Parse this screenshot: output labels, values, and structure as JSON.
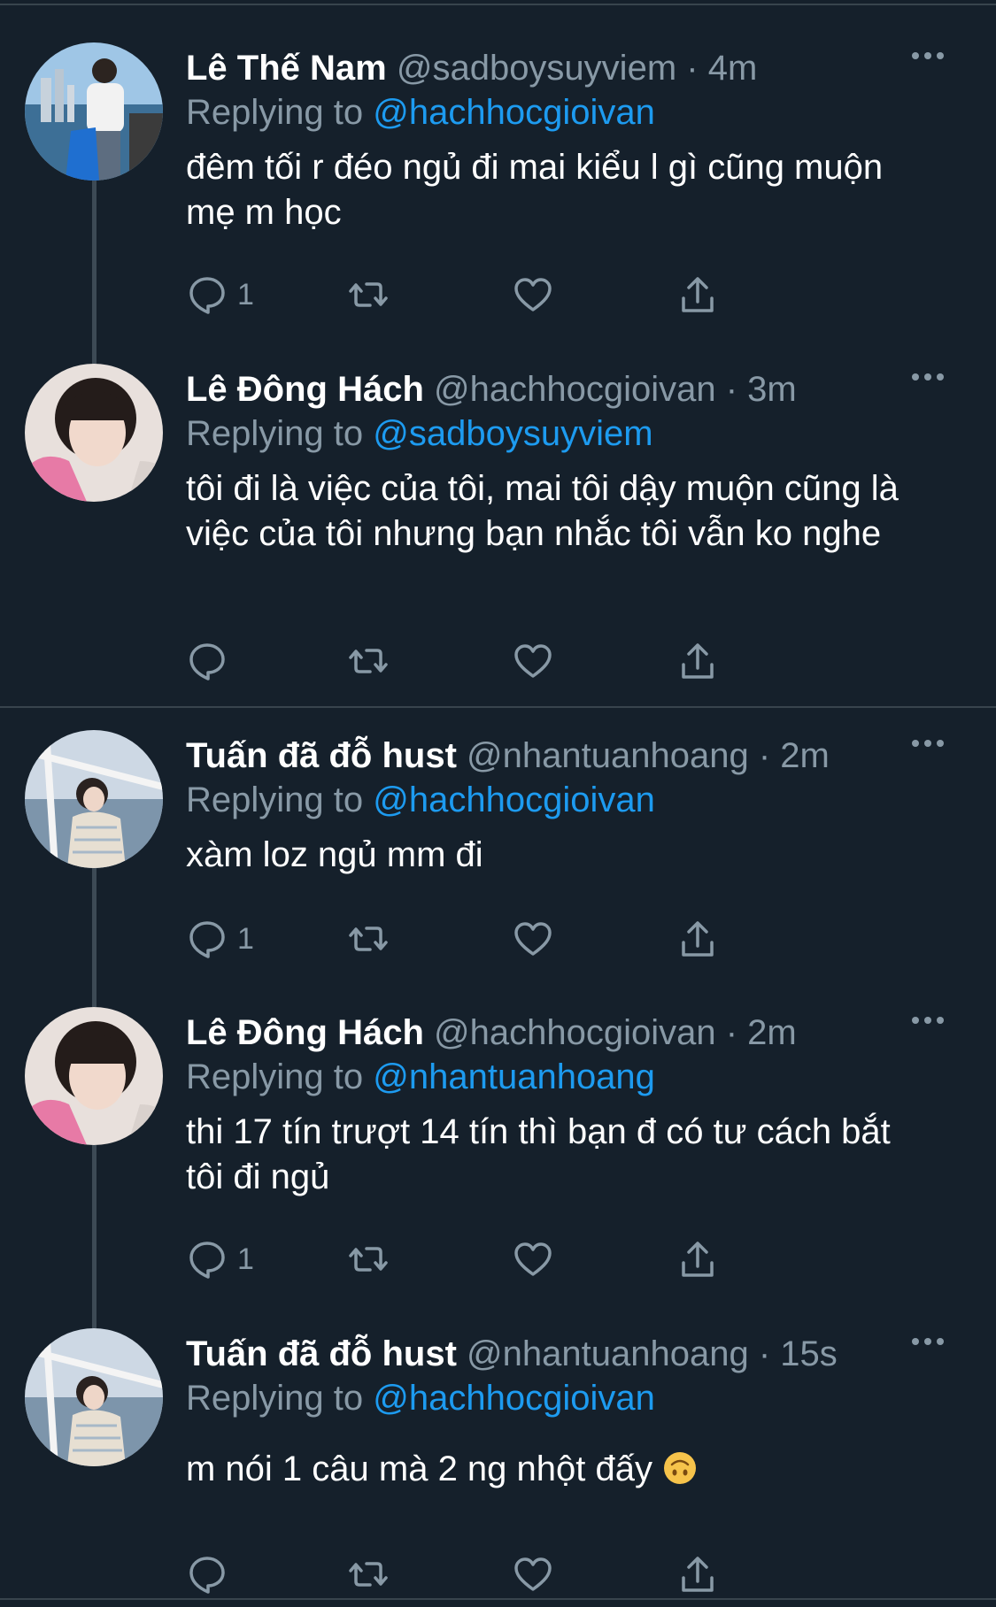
{
  "tweets": [
    {
      "name": "Lê Thế Nam",
      "handle": "@sadboysuyviem",
      "time": "· 4m",
      "replying_label": "Replying to",
      "replying_to": "@hachhocgioivan",
      "text": "đêm tối r đéo ngủ đi mai kiểu l gì cũng muộn mẹ m học",
      "reply_count": "1"
    },
    {
      "name": "Lê Đông Hách",
      "handle": "@hachhocgioivan",
      "time": "· 3m",
      "replying_label": "Replying to",
      "replying_to": "@sadboysuyviem",
      "text": "tôi đi là việc của tôi, mai tôi dậy muộn cũng là việc của tôi nhưng bạn nhắc tôi vẫn ko nghe",
      "reply_count": ""
    },
    {
      "name": "Tuấn đã đỗ hust",
      "handle": "@nhantuanhoang",
      "time": "· 2m",
      "replying_label": "Replying to",
      "replying_to": "@hachhocgioivan",
      "text": "xàm loz ngủ mm đi",
      "reply_count": "1"
    },
    {
      "name": "Lê Đông Hách",
      "handle": "@hachhocgioivan",
      "time": "· 2m",
      "replying_label": "Replying to",
      "replying_to": "@nhantuanhoang",
      "text": "thi 17 tín trượt 14 tín thì bạn đ có tư cách bắt tôi đi ngủ",
      "reply_count": "1"
    },
    {
      "name": "Tuấn đã đỗ hust",
      "handle": "@nhantuanhoang",
      "time": "· 15s",
      "replying_label": "Replying to",
      "replying_to": "@hachhocgioivan",
      "text": "m nói 1 câu mà 2 ng nhột đấy",
      "reply_count": ""
    }
  ],
  "icons": {
    "reply": "speech-bubble-icon",
    "retweet": "retweet-arrows-icon",
    "like": "heart-icon",
    "share": "share-upload-icon",
    "more": "ellipsis-icon",
    "emoji": "upside-down-face-emoji"
  },
  "colors": {
    "background": "#15202b",
    "secondary_text": "#8899a6",
    "link": "#1d9bf0",
    "divider": "#38444d"
  }
}
